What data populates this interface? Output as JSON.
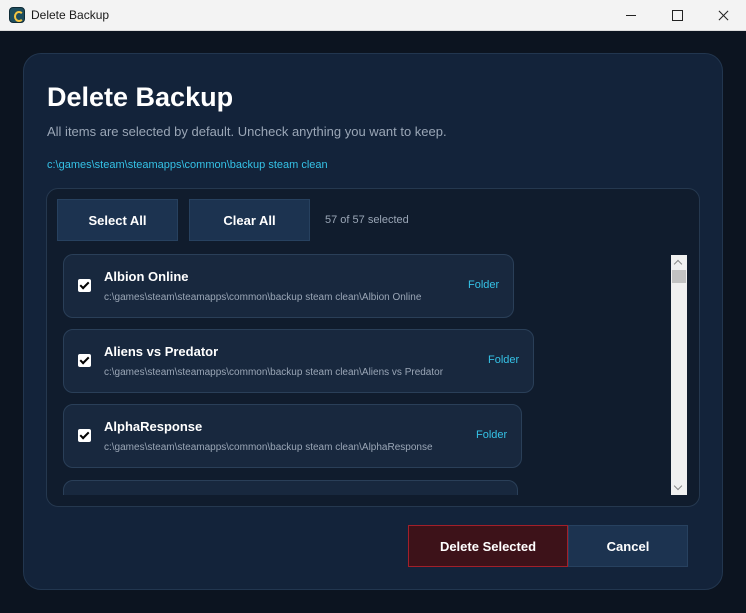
{
  "window": {
    "title": "Delete Backup"
  },
  "dialog": {
    "heading": "Delete Backup",
    "subtitle": "All items are selected by default. Uncheck anything you want to keep.",
    "path": "c:\\games\\steam\\steamapps\\common\\backup steam clean"
  },
  "toolbar": {
    "select_all_label": "Select All",
    "clear_all_label": "Clear All",
    "selection_count": "57 of 57 selected"
  },
  "items": [
    {
      "name": "Albion Online",
      "path": "c:\\games\\steam\\steamapps\\common\\backup steam clean\\Albion Online",
      "link": "Folder",
      "checked": true
    },
    {
      "name": "Aliens vs Predator",
      "path": "c:\\games\\steam\\steamapps\\common\\backup steam clean\\Aliens vs Predator",
      "link": "Folder",
      "checked": true
    },
    {
      "name": "AlphaResponse",
      "path": "c:\\games\\steam\\steamapps\\common\\backup steam clean\\AlphaResponse",
      "link": "Folder",
      "checked": true
    }
  ],
  "footer": {
    "delete_label": "Delete Selected",
    "cancel_label": "Cancel"
  },
  "colors": {
    "background": "#0c1420",
    "card": "#13233a",
    "accent": "#35c2e6",
    "danger_border": "#a21f2a"
  }
}
